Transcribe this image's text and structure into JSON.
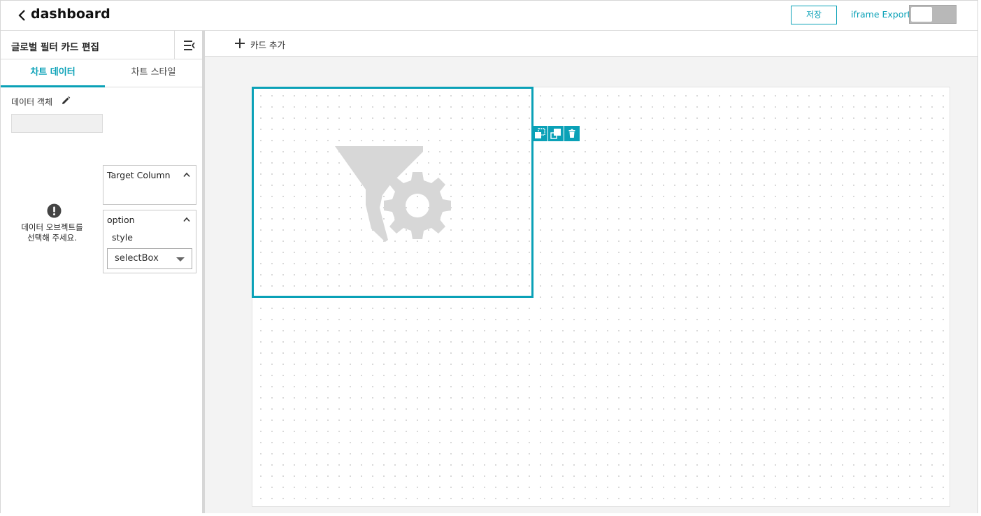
{
  "header": {
    "title": "dashboard",
    "save_label": "저장",
    "export_label": "iframe Export",
    "export_toggle_on": false
  },
  "left_panel": {
    "title": "글로벌 필터 카드 편집",
    "tabs": [
      {
        "label": "차트 데이터",
        "active": true
      },
      {
        "label": "차트 스타일",
        "active": false
      }
    ],
    "data_object_label": "데이터 객체",
    "data_object_value": "",
    "warning_message_line1": "데이터 오브젝트를",
    "warning_message_line2": "선택해 주세요.",
    "target_column_title": "Target Column",
    "option_title": "option",
    "style_label": "style",
    "style_select_value": "selectBox"
  },
  "toolbar": {
    "add_card_label": "카드 추가"
  },
  "colors": {
    "accent": "#0aa1b7",
    "icon_gray": "#d7d7d7"
  },
  "icons": {
    "back": "chevron-left-icon",
    "collapse": "collapse-panel-icon",
    "edit": "pencil-icon",
    "warning": "exclamation-circle-icon",
    "add": "plus-icon",
    "copy": "copy-icon",
    "maximize": "maximize-icon",
    "delete": "trash-icon",
    "card_placeholder": "filter-gear-icon"
  }
}
